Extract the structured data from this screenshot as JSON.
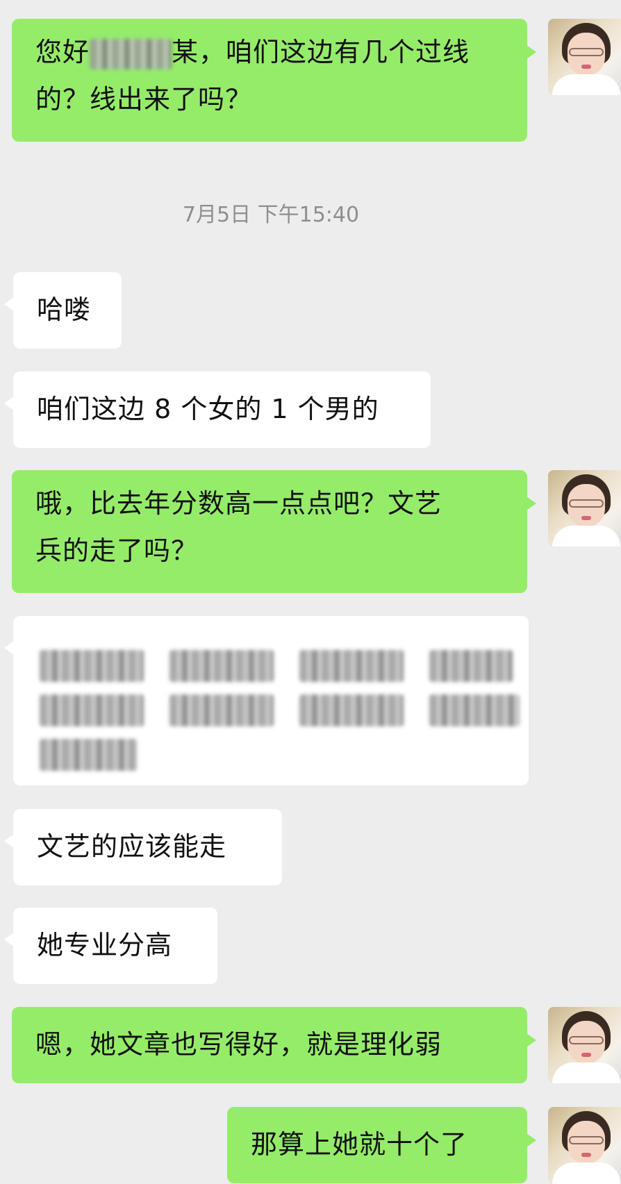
{
  "timestamp": "7月5日 下午15:40",
  "messages": [
    {
      "sender": "me",
      "line1_prefix": "您好",
      "line1_suffix": "某，咱们这边有几个过线",
      "line2": "的？线出来了吗？"
    },
    {
      "sender": "other",
      "text": "哈喽"
    },
    {
      "sender": "other",
      "text": "咱们这边 8 个女的 1 个男的"
    },
    {
      "sender": "me",
      "line1": "哦，比去年分数高一点点吧？文艺",
      "line2": "兵的走了吗？"
    },
    {
      "sender": "other",
      "text": "",
      "note": "blurred"
    },
    {
      "sender": "other",
      "text": "文艺的应该能走"
    },
    {
      "sender": "other",
      "text": "她专业分高"
    },
    {
      "sender": "me",
      "text": "嗯，她文章也写得好，就是理化弱"
    },
    {
      "sender": "me",
      "text": "那算上她就十个了"
    }
  ],
  "colors": {
    "me_bubble": "#95ec69",
    "other_bubble": "#ffffff",
    "background": "#ededed"
  }
}
